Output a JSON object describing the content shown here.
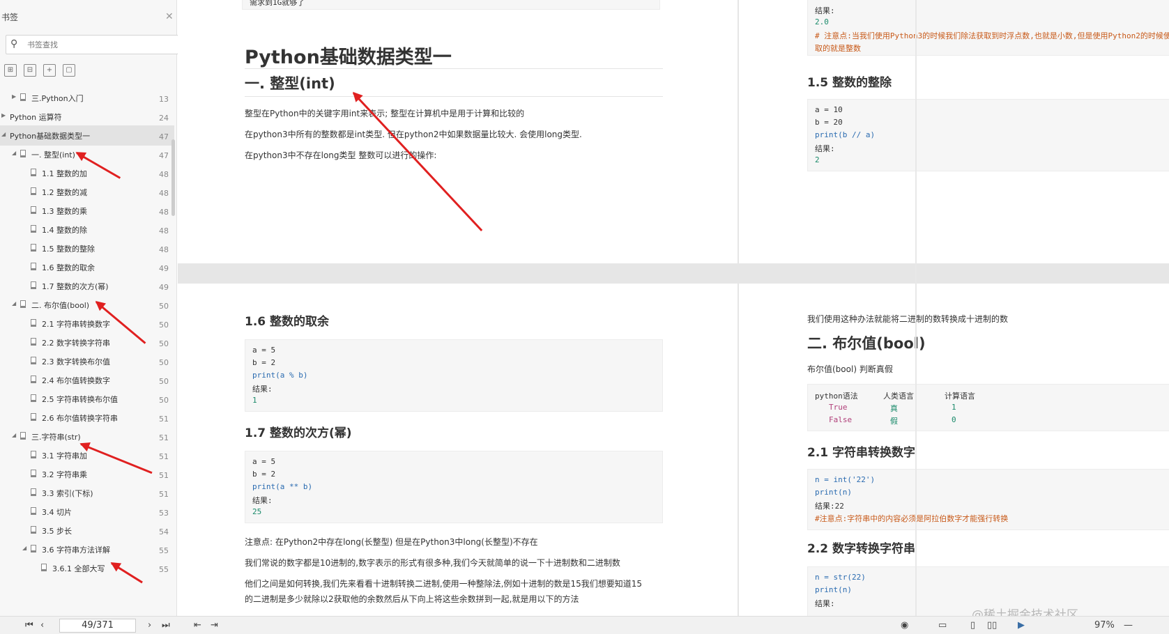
{
  "sidebar": {
    "title": "书签",
    "search_placeholder": "书签查找",
    "items": [
      {
        "label": "三.Python入门",
        "page": "13"
      },
      {
        "label": "Python 运算符",
        "page": "24"
      },
      {
        "label": "Python基础数据类型一",
        "page": "47"
      },
      {
        "label": "一. 整型(int)",
        "page": "47"
      },
      {
        "label": "1.1 整数的加",
        "page": "48"
      },
      {
        "label": "1.2 整数的减",
        "page": "48"
      },
      {
        "label": "1.3 整数的乘",
        "page": "48"
      },
      {
        "label": "1.4 整数的除",
        "page": "48"
      },
      {
        "label": "1.5 整数的整除",
        "page": "48"
      },
      {
        "label": "1.6 整数的取余",
        "page": "49"
      },
      {
        "label": "1.7 整数的次方(幂)",
        "page": "49"
      },
      {
        "label": "二. 布尔值(bool)",
        "page": "50"
      },
      {
        "label": "2.1 字符串转换数字",
        "page": "50"
      },
      {
        "label": "2.2 数字转换字符串",
        "page": "50"
      },
      {
        "label": "2.3 数字转换布尔值",
        "page": "50"
      },
      {
        "label": "2.4 布尔值转换数字",
        "page": "50"
      },
      {
        "label": "2.5 字符串转换布尔值",
        "page": "50"
      },
      {
        "label": "2.6 布尔值转换字符串",
        "page": "51"
      },
      {
        "label": "三.字符串(str)",
        "page": "51"
      },
      {
        "label": "3.1 字符串加",
        "page": "51"
      },
      {
        "label": "3.2 字符串乘",
        "page": "51"
      },
      {
        "label": "3.3 索引(下标)",
        "page": "51"
      },
      {
        "label": "3.4 切片",
        "page": "53"
      },
      {
        "label": "3.5 步长",
        "page": "54"
      },
      {
        "label": "3.6 字符串方法详解",
        "page": "55"
      },
      {
        "label": "3.6.1 全部大写",
        "page": "55"
      }
    ]
  },
  "bottom": {
    "page_indicator": "49/371",
    "zoom": "97%"
  },
  "pageA": {
    "title": "Python基础数据类型一",
    "h_int": "一. 整型(int)",
    "p1": "整型在Python中的关键字用int来表示; 整型在计算机中是用于计算和比较的",
    "p2": "在python3中所有的整数都是int类型. 但在python2中如果数据量比较大. 会使用long类型.",
    "p3": "在python3中不存在long类型 整数可以进行的操作:"
  },
  "pageB": {
    "result_label": "结果:",
    "result_val": "2.0",
    "note1": "# 注意点:当我们使用Python3的时候我们除法获取到时浮点数,也就是小数,但是使用Python2的时候使用除法获",
    "note2": "取的就是整数",
    "h_floor": "1.5 整数的整除",
    "code": [
      "a = 10",
      "b = 20",
      "print(b // a)",
      "结果:",
      "2"
    ]
  },
  "pageC": {
    "h_mod": "1.6 整数的取余",
    "code_mod": [
      "a = 5",
      "b = 2",
      "print(a % b)",
      "结果:",
      "1"
    ],
    "h_pow": "1.7 整数的次方(幂)",
    "code_pow": [
      "a = 5",
      "b = 2",
      "print(a ** b)",
      "结果:",
      "25"
    ],
    "n1": "注意点: 在Python2中存在long(长整型) 但是在Python3中long(长整型)不存在",
    "n2": "我们常说的数字都是10进制的,数字表示的形式有很多种,我们今天就简单的说一下十进制数和二进制数",
    "n3": "他们之间是如何转换,我们先来看看十进制转换二进制,使用一种整除法,例如十进制的数是15我们想要知道15",
    "n4": "的二进制是多少就除以2获取他的余数然后从下向上将这些余数拼到一起,就是用以下的方法"
  },
  "pageD": {
    "intro": "我们使用这种办法就能将二进制的数转换成十进制的数",
    "h_bool": "二. 布尔值(bool)",
    "p_bool": "布尔值(bool) 判断真假",
    "table_head": [
      "python语法",
      "人类语言",
      "计算语言"
    ],
    "table_rows": [
      [
        "True",
        "真",
        "1"
      ],
      [
        "False",
        "假",
        "0"
      ]
    ],
    "h_str2num": "2.1 字符串转换数字",
    "code_s2n": [
      "n = int('22')",
      "print(n)",
      "结果:22",
      "#注意点:字符串中的内容必须是阿拉伯数字才能强行转换"
    ],
    "h_num2str": "2.2 数字转换字符串",
    "code_n2s": [
      "n = str(22)",
      "print(n)",
      "结果:"
    ],
    "top_snippet": "需求到1G就够了"
  },
  "watermark": "@稀土掘金技术社区"
}
